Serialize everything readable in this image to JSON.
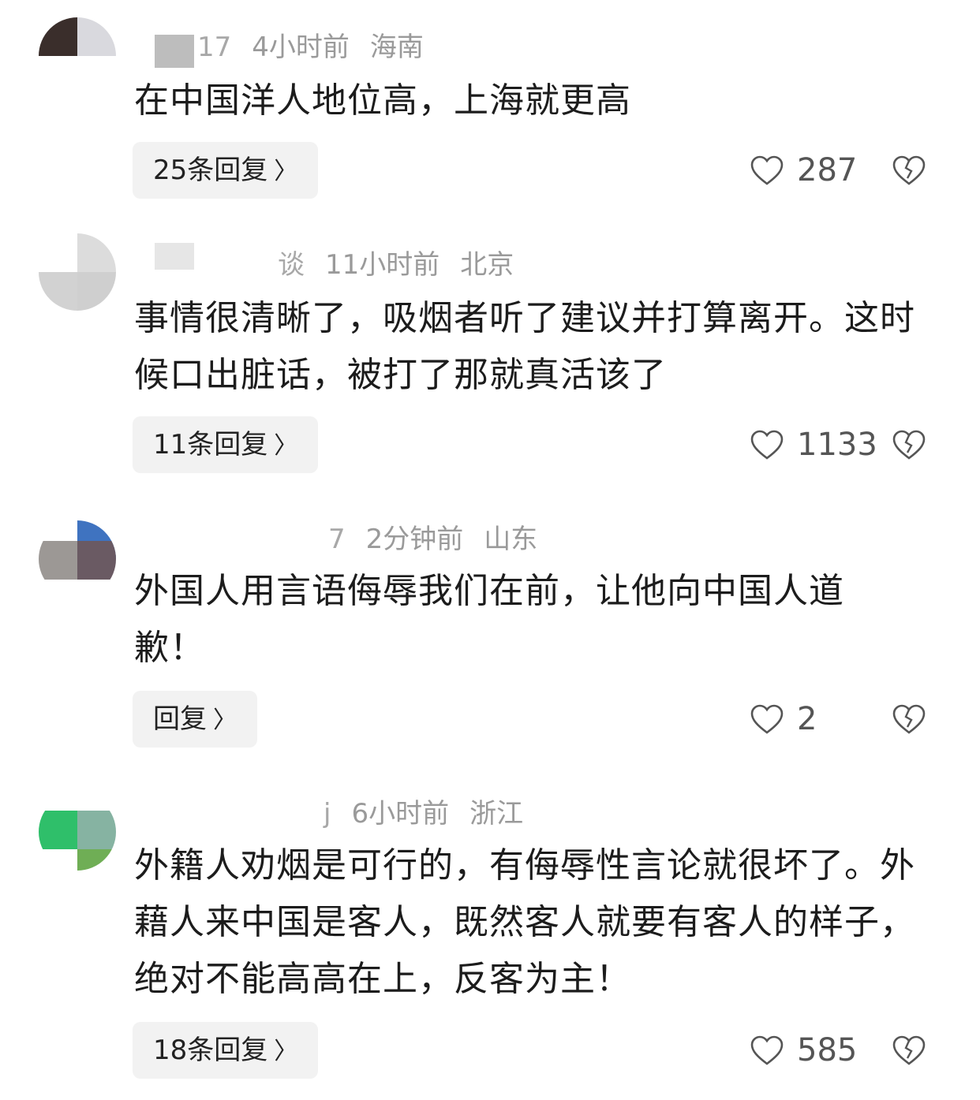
{
  "comments": [
    {
      "user": "17",
      "time": "4小时前",
      "location": "海南",
      "text": "在中国洋人地位高，上海就更高",
      "reply_label": "25条回复",
      "likes": "287"
    },
    {
      "user": "谈",
      "time": "11小时前",
      "location": "北京",
      "text": "事情很清晰了，吸烟者听了建议并打算离开。这时候口出脏话，被打了那就真活该了",
      "reply_label": "11条回复",
      "likes": "1133"
    },
    {
      "user": "7",
      "time": "2分钟前",
      "location": "山东",
      "text": "外国人用言语侮辱我们在前，让他向中国人道歉！",
      "reply_label": "回复",
      "likes": "2"
    },
    {
      "user": "j",
      "time": "6小时前",
      "location": "浙江",
      "text": "外籍人劝烟是可行的，有侮辱性言论就很坏了。外藉人来中国是客人，既然客人就要有客人的样子，绝对不能高高在上，反客为主！",
      "reply_label": "18条回复",
      "likes": "585"
    }
  ],
  "icons": {
    "chevron": "chevron-right-icon",
    "like": "heart-outline-icon",
    "dislike": "broken-heart-icon"
  },
  "colors": {
    "meta_text": "#9a9a9a",
    "reply_bg": "#f2f2f2",
    "body_text": "#1c1c1c"
  }
}
